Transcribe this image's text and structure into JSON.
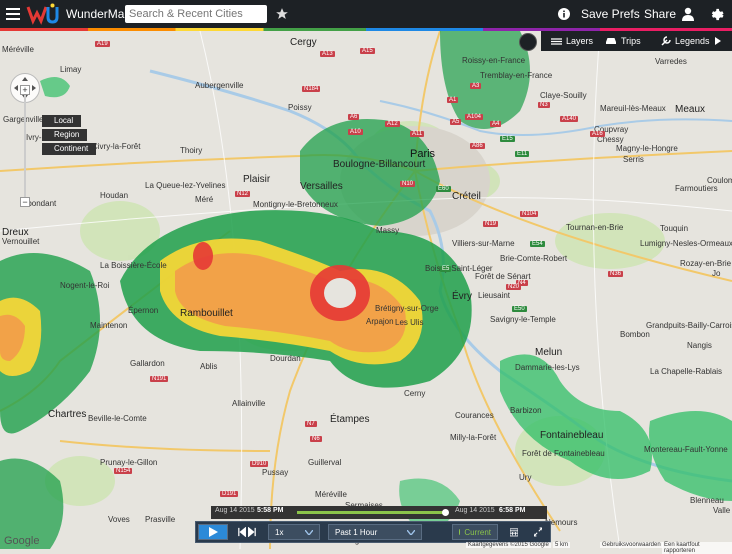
{
  "topbar": {
    "logo_text": "WunderMap",
    "search_placeholder": "Search & Recent Cities",
    "save_prefs": "Save Prefs",
    "share": "Share"
  },
  "right_panel": {
    "layers": "Layers",
    "trips": "Trips",
    "legends": "Legends"
  },
  "zoom": {
    "plus": "+",
    "minus": "−",
    "levels": [
      "Local",
      "Region",
      "Continent"
    ]
  },
  "playback": {
    "start_date": "Aug 14 2015",
    "start_time": "5:58 PM",
    "end_date": "Aug 14 2015",
    "end_time": "6:58 PM",
    "speed": "1x",
    "range": "Past 1 Hour",
    "current": "Current"
  },
  "attribution": {
    "data": "Kaartgegevens ©2015 Google",
    "scale": "5 km",
    "terms": "Gebruiksvoorwaarden",
    "report": "Een kaartfout rapporteren",
    "google": "Google"
  },
  "places": [
    {
      "name": "Méréville",
      "cls": ""
    },
    {
      "name": "Limay",
      "cls": ""
    },
    {
      "name": "Aubergenville",
      "cls": ""
    },
    {
      "name": "Cergy",
      "cls": "big"
    },
    {
      "name": "Poissy",
      "cls": ""
    },
    {
      "name": "Gargenville",
      "cls": ""
    },
    {
      "name": "Ivry-la-Bataille",
      "cls": ""
    },
    {
      "name": "Civry-la-Forêt",
      "cls": ""
    },
    {
      "name": "Thoiry",
      "cls": ""
    },
    {
      "name": "Houdan",
      "cls": ""
    },
    {
      "name": "La Queue-lez-Yvelines",
      "cls": ""
    },
    {
      "name": "Méré",
      "cls": ""
    },
    {
      "name": "Plaisir",
      "cls": "big"
    },
    {
      "name": "Versailles",
      "cls": "big"
    },
    {
      "name": "Montigny-le-Bretonneux",
      "cls": ""
    },
    {
      "name": "Paris",
      "cls": "major"
    },
    {
      "name": "Boulogne-Billancourt",
      "cls": "big"
    },
    {
      "name": "Créteil",
      "cls": "big"
    },
    {
      "name": "Dreux",
      "cls": "big"
    },
    {
      "name": "Vernouillet",
      "cls": ""
    },
    {
      "name": "Ébondant",
      "cls": ""
    },
    {
      "name": "Rambouillet",
      "cls": "big"
    },
    {
      "name": "La Boissière-École",
      "cls": ""
    },
    {
      "name": "Nogent-le-Roi",
      "cls": ""
    },
    {
      "name": "Épernon",
      "cls": ""
    },
    {
      "name": "Maintenon",
      "cls": ""
    },
    {
      "name": "Massy",
      "cls": ""
    },
    {
      "name": "Les Ulis",
      "cls": ""
    },
    {
      "name": "Brétigny-sur-Orge",
      "cls": ""
    },
    {
      "name": "Arpajon",
      "cls": ""
    },
    {
      "name": "Évry",
      "cls": "big"
    },
    {
      "name": "Lieusaint",
      "cls": ""
    },
    {
      "name": "Savigny-le-Temple",
      "cls": ""
    },
    {
      "name": "Brie-Comte-Robert",
      "cls": ""
    },
    {
      "name": "Forêt de Sénart",
      "cls": ""
    },
    {
      "name": "Melun",
      "cls": "big"
    },
    {
      "name": "Dammarie-les-Lys",
      "cls": ""
    },
    {
      "name": "Gallardon",
      "cls": ""
    },
    {
      "name": "Ablis",
      "cls": ""
    },
    {
      "name": "Dourdan",
      "cls": ""
    },
    {
      "name": "Allainville",
      "cls": ""
    },
    {
      "name": "Chartres",
      "cls": "big"
    },
    {
      "name": "Beville-le-Comte",
      "cls": ""
    },
    {
      "name": "Étampes",
      "cls": "big"
    },
    {
      "name": "Cerny",
      "cls": ""
    },
    {
      "name": "Courances",
      "cls": ""
    },
    {
      "name": "Milly-la-Forêt",
      "cls": ""
    },
    {
      "name": "Barbizon",
      "cls": ""
    },
    {
      "name": "Fontainebleau",
      "cls": "big"
    },
    {
      "name": "Forêt de Fontainebleau",
      "cls": ""
    },
    {
      "name": "Montereau-Fault-Yonne",
      "cls": ""
    },
    {
      "name": "Prunay-le-Gillon",
      "cls": ""
    },
    {
      "name": "Pussay",
      "cls": ""
    },
    {
      "name": "Guillerval",
      "cls": ""
    },
    {
      "name": "Méréville",
      "cls": ""
    },
    {
      "name": "Sermaises",
      "cls": ""
    },
    {
      "name": "Voves",
      "cls": ""
    },
    {
      "name": "Prasville",
      "cls": ""
    },
    {
      "name": "Engenville",
      "cls": ""
    },
    {
      "name": "Nemours",
      "cls": ""
    },
    {
      "name": "Ury",
      "cls": ""
    },
    {
      "name": "Claye-Souilly",
      "cls": ""
    },
    {
      "name": "Mareuil-lès-Meaux",
      "cls": ""
    },
    {
      "name": "Meaux",
      "cls": "big"
    },
    {
      "name": "Coupvray",
      "cls": ""
    },
    {
      "name": "Chessy",
      "cls": ""
    },
    {
      "name": "Magny-le-Hongre",
      "cls": ""
    },
    {
      "name": "Serris",
      "cls": ""
    },
    {
      "name": "Varredes",
      "cls": ""
    },
    {
      "name": "Farmoutiers",
      "cls": ""
    },
    {
      "name": "Coulom",
      "cls": ""
    },
    {
      "name": "Tournan-en-Brie",
      "cls": ""
    },
    {
      "name": "Touquin",
      "cls": ""
    },
    {
      "name": "Lumigny-Nesles-Ormeaux",
      "cls": ""
    },
    {
      "name": "Rozay-en-Brie",
      "cls": ""
    },
    {
      "name": "Bombon",
      "cls": ""
    },
    {
      "name": "Grandpuits-Bailly-Carrois",
      "cls": ""
    },
    {
      "name": "Nangis",
      "cls": ""
    },
    {
      "name": "La Chapelle-Rablais",
      "cls": ""
    },
    {
      "name": "Tremblay-en-France",
      "cls": ""
    },
    {
      "name": "Roissy-en-France",
      "cls": ""
    },
    {
      "name": "Boissy-Saint-Léger",
      "cls": ""
    },
    {
      "name": "Villiers-sur-Marne",
      "cls": ""
    },
    {
      "name": "Jo",
      "cls": ""
    },
    {
      "name": "Valle",
      "cls": ""
    },
    {
      "name": "Blenneau",
      "cls": ""
    }
  ],
  "roads": [
    "A13",
    "A15",
    "A1",
    "A3",
    "A4",
    "A86",
    "A6",
    "A10",
    "A11",
    "A12",
    "A5",
    "A104",
    "A140",
    "N12",
    "N184",
    "N10",
    "N19",
    "N104",
    "N36",
    "N4",
    "N20",
    "N191",
    "N154",
    "N7",
    "N6",
    "E5",
    "E50",
    "E15",
    "E60",
    "E11",
    "E54",
    "A16",
    "N3",
    "A19",
    "D191",
    "D910"
  ]
}
